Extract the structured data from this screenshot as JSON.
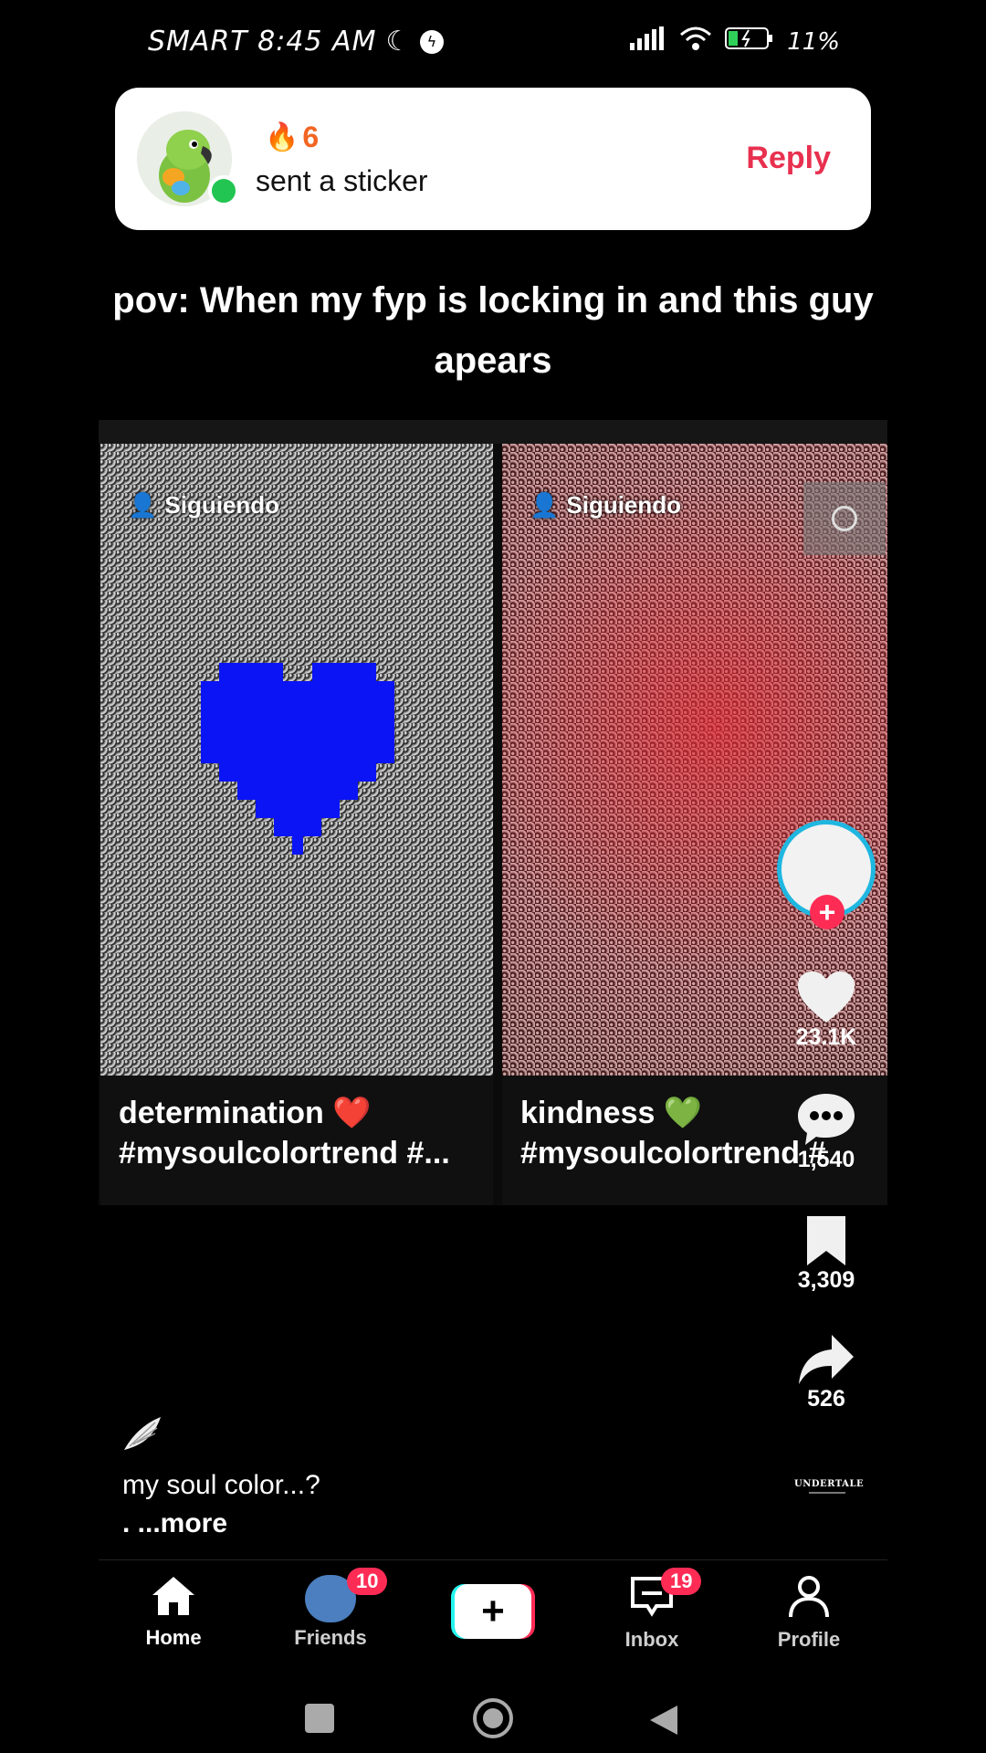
{
  "status_bar": {
    "carrier_time": "SMART 8:45 AM",
    "battery": "11%"
  },
  "notification": {
    "streak_count": "6",
    "message": "sent a sticker",
    "reply_label": "Reply"
  },
  "video": {
    "overlay_text": "pov: When my fyp is locking in and this guy apears",
    "panels": [
      {
        "following_label": "Siguiendo",
        "caption_line1": "determination ❤️",
        "caption_line2": "#mysoulcolortrend #..."
      },
      {
        "following_label": "Siguiendo",
        "caption_line1": "kindness 💚",
        "caption_line2": "#mysoulcolortrend #"
      }
    ]
  },
  "actions": {
    "likes": "23.1K",
    "comments": "1,540",
    "saves": "3,309",
    "shares": "526"
  },
  "post": {
    "description": "my soul color...?",
    "more_label": ". ...more",
    "music_label": "UNDERTALE"
  },
  "nav": {
    "home": "Home",
    "friends": "Friends",
    "friends_badge": "10",
    "inbox": "Inbox",
    "inbox_badge": "19",
    "profile": "Profile"
  },
  "colors": {
    "accent": "#fe2c55",
    "reply": "#e8304f",
    "streak": "#f26522",
    "online": "#23c552"
  }
}
